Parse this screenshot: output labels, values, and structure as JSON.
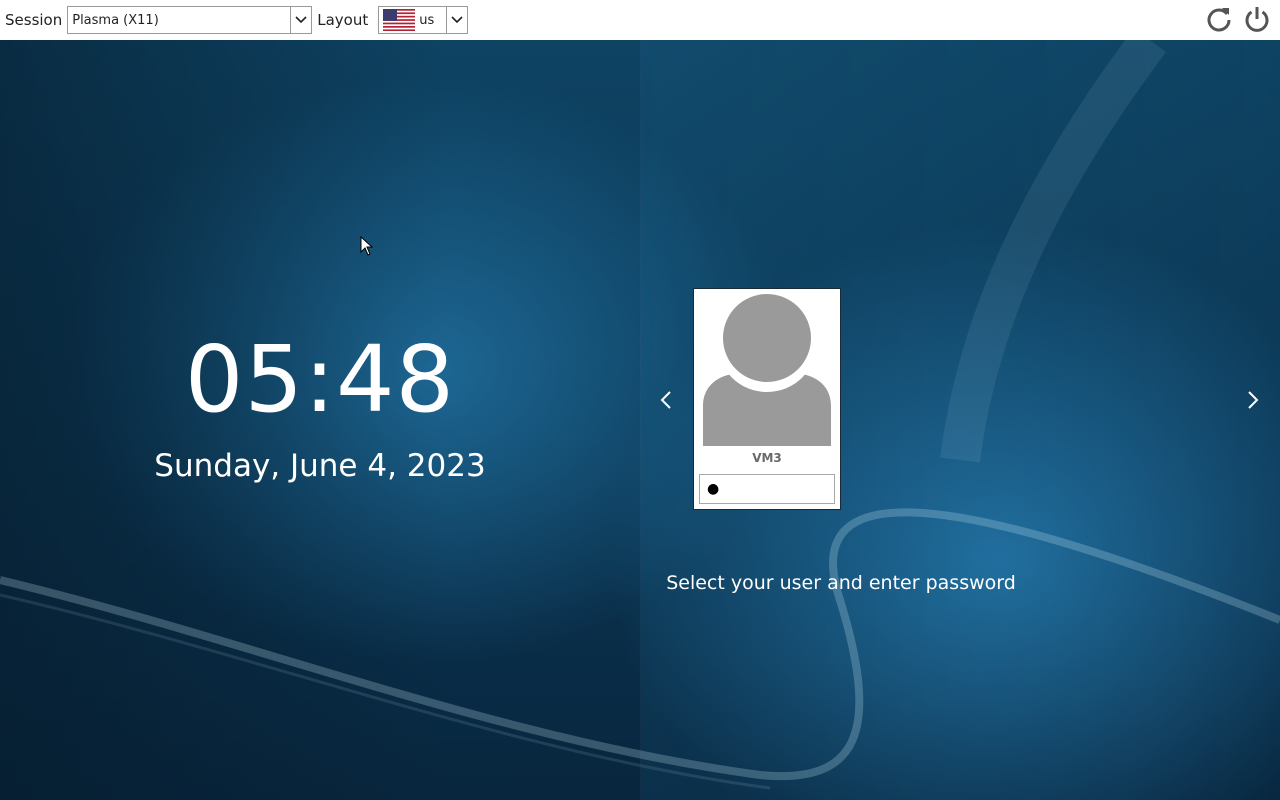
{
  "topbar": {
    "session_label": "Session",
    "session_value": "Plasma (X11)",
    "layout_label": "Layout",
    "layout_value": "us",
    "icons": [
      "reboot-icon",
      "power-icon"
    ]
  },
  "clock": {
    "time": "05:48",
    "date": "Sunday, June 4, 2023"
  },
  "login": {
    "user_name": "VM3",
    "password_mask": "●",
    "hint": "Select your user and enter password"
  },
  "colors": {
    "background_dark": "#08263e",
    "background_mid": "#0e4363",
    "text_light": "#ffffff"
  }
}
